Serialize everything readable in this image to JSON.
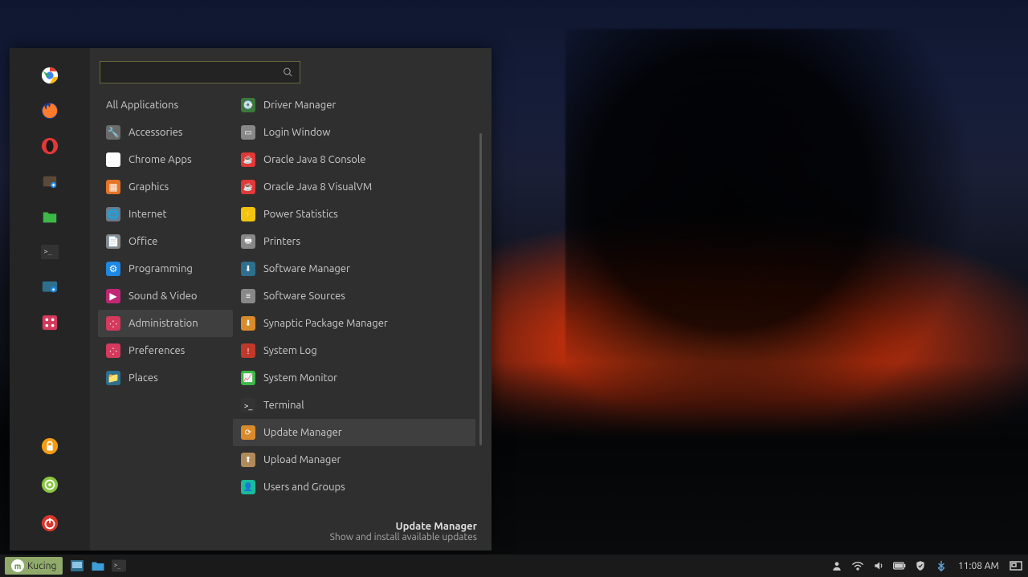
{
  "menu": {
    "search_placeholder": "",
    "favorites": [
      {
        "name": "chrome",
        "color": "#fff"
      },
      {
        "name": "firefox",
        "color": "#ff7b2b"
      },
      {
        "name": "opera",
        "color": "#e23838"
      },
      {
        "name": "software-manager",
        "color": "#333"
      },
      {
        "name": "files",
        "color": "#3db847"
      },
      {
        "name": "terminal",
        "color": "#333"
      },
      {
        "name": "settings",
        "color": "#2e6f8e"
      },
      {
        "name": "dice",
        "color": "#d43a5c"
      }
    ],
    "favorites_bottom": [
      {
        "name": "lock",
        "color": "#f39c12"
      },
      {
        "name": "logout",
        "color": "#89c540"
      },
      {
        "name": "shutdown",
        "color": "#d9372c"
      }
    ],
    "categories": [
      {
        "label": "All Applications",
        "icon": "",
        "selected": false,
        "all": true
      },
      {
        "label": "Accessories",
        "icon": "🔧",
        "iconbg": "#6b6b6b",
        "selected": false
      },
      {
        "label": "Chrome Apps",
        "icon": "◉",
        "iconbg": "#ffffff",
        "selected": false
      },
      {
        "label": "Graphics",
        "icon": "▦",
        "iconbg": "#e57328",
        "selected": false
      },
      {
        "label": "Internet",
        "icon": "🌐",
        "iconbg": "#6c7a89",
        "selected": false
      },
      {
        "label": "Office",
        "icon": "📄",
        "iconbg": "#888",
        "selected": false
      },
      {
        "label": "Programming",
        "icon": "⚙",
        "iconbg": "#1e88e5",
        "selected": false
      },
      {
        "label": "Sound & Video",
        "icon": "▶",
        "iconbg": "#c02673",
        "selected": false
      },
      {
        "label": "Administration",
        "icon": "⁘",
        "iconbg": "#d43a5c",
        "selected": true
      },
      {
        "label": "Preferences",
        "icon": "⁘",
        "iconbg": "#d43a5c",
        "selected": false
      },
      {
        "label": "Places",
        "icon": "📁",
        "iconbg": "#2e6f8e",
        "selected": false
      }
    ],
    "apps": [
      {
        "label": "Driver Manager",
        "icon": "💽",
        "iconbg": "#3a7a3a"
      },
      {
        "label": "Login Window",
        "icon": "▭",
        "iconbg": "#888"
      },
      {
        "label": "Oracle Java 8 Console",
        "icon": "☕",
        "iconbg": "#e23838"
      },
      {
        "label": "Oracle Java 8 VisualVM",
        "icon": "☕",
        "iconbg": "#e23838"
      },
      {
        "label": "Power Statistics",
        "icon": "⚡",
        "iconbg": "#f1c40f"
      },
      {
        "label": "Printers",
        "icon": "🖶",
        "iconbg": "#888"
      },
      {
        "label": "Software Manager",
        "icon": "⬇",
        "iconbg": "#2e6f8e"
      },
      {
        "label": "Software Sources",
        "icon": "≡",
        "iconbg": "#888"
      },
      {
        "label": "Synaptic Package Manager",
        "icon": "⬇",
        "iconbg": "#d98b2b"
      },
      {
        "label": "System Log",
        "icon": "!",
        "iconbg": "#c0392b"
      },
      {
        "label": "System Monitor",
        "icon": "📈",
        "iconbg": "#3db847"
      },
      {
        "label": "Terminal",
        "icon": ">_",
        "iconbg": "#333"
      },
      {
        "label": "Update Manager",
        "icon": "⟳",
        "iconbg": "#d98b2b",
        "selected": true
      },
      {
        "label": "Upload Manager",
        "icon": "⬆",
        "iconbg": "#b18a5a"
      },
      {
        "label": "Users and Groups",
        "icon": "👤",
        "iconbg": "#1abc9c"
      }
    ],
    "footer": {
      "title": "Update Manager",
      "description": "Show and install available updates"
    }
  },
  "taskbar": {
    "start_label": "Kucing",
    "launchers": [
      {
        "name": "show-desktop"
      },
      {
        "name": "files"
      },
      {
        "name": "terminal"
      }
    ],
    "tray": [
      {
        "name": "user-icon"
      },
      {
        "name": "wifi-icon"
      },
      {
        "name": "volume-icon"
      },
      {
        "name": "battery-icon"
      },
      {
        "name": "shield-icon"
      },
      {
        "name": "bluetooth-icon"
      }
    ],
    "clock": "11:08 AM"
  }
}
